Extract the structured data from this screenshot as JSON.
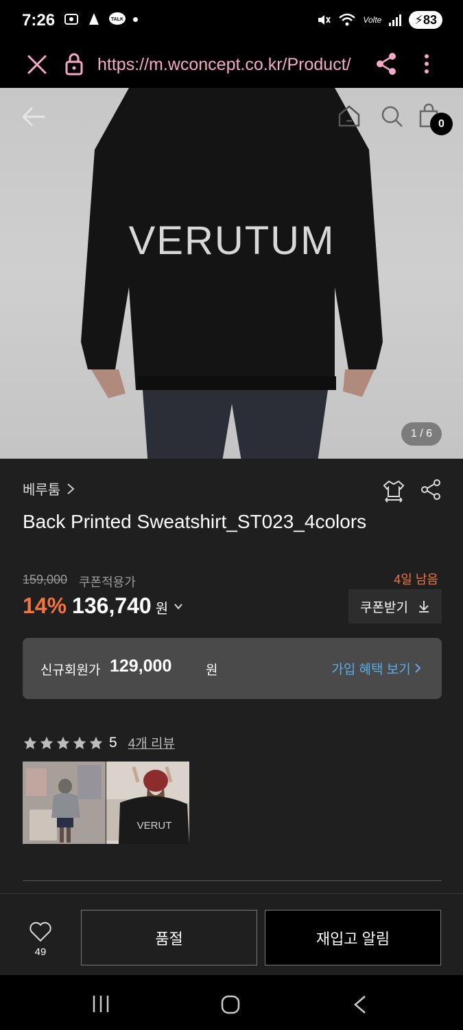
{
  "status_bar": {
    "time": "7:26",
    "battery": "83",
    "network": "Volte"
  },
  "browser": {
    "url": "https://m.wconcept.co.kr/Product/",
    "icons": [
      "close-icon",
      "lock-icon",
      "share-icon",
      "more-icon"
    ]
  },
  "hero": {
    "brand_print": "VERUTUM",
    "page_indicator": "1 / 6",
    "cart_count": "0",
    "icons": [
      "back-arrow-icon",
      "home-icon",
      "search-icon",
      "bag-icon"
    ]
  },
  "product": {
    "brand": "베루툼",
    "title": "Back Printed Sweatshirt_ST023_4colors",
    "original_price": "159,000",
    "coupon_label": "쿠폰적용가",
    "days_left": "4일 남음",
    "discount": "14%",
    "price": "136,740",
    "currency": "원",
    "coupon_button": "쿠폰받기"
  },
  "member": {
    "label": "신규회원가",
    "price": "129,000",
    "currency": "원",
    "link": "가입 혜택 보기"
  },
  "reviews": {
    "score": "5",
    "stars": 5,
    "link": "4개 리뷰",
    "thumb_print": "VERUT"
  },
  "actions": {
    "like_count": "49",
    "soldout": "품절",
    "restock": "재입고 알림"
  },
  "colors": {
    "accent_orange": "#f3743f",
    "link_blue": "#58aee8",
    "url_pink": "#f4a9c9",
    "background": "#1f1f1f"
  }
}
